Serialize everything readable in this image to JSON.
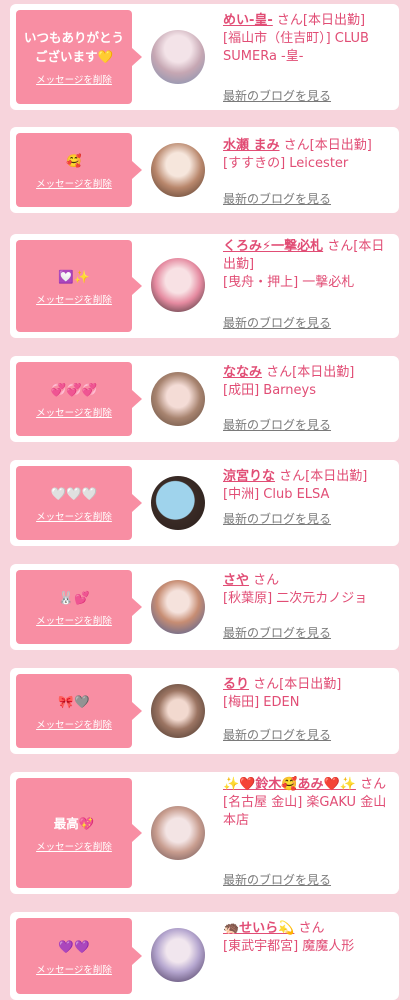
{
  "delete_label": "メッセージを削除",
  "blog_label": "最新のブログを見る",
  "cast": [
    {
      "message": "いつもありがとうございます💛",
      "name": "めい-皇-",
      "suffix": " さん[本日出勤]",
      "shop": "[福山市（住吉町）] CLUB SUMERa -皇-"
    },
    {
      "message": "🥰",
      "name": "水瀬 まみ",
      "suffix": " さん[本日出勤]",
      "shop": "[すすきの] Leicester"
    },
    {
      "message": "💟✨",
      "name": "くろみ⚡一撃必札",
      "suffix": " さん[本日出勤]",
      "shop": "[曳舟・押上] 一撃必札"
    },
    {
      "message": "💞💞💞",
      "name": "ななみ",
      "suffix": " さん[本日出勤]",
      "shop": "[成田] Barneys"
    },
    {
      "message": "🤍🤍🤍",
      "name": "涼宮りな",
      "suffix": " さん[本日出勤]",
      "shop": "[中洲] Club ELSA"
    },
    {
      "message": "🐰💕",
      "name": "さや",
      "suffix": " さん",
      "shop": "[秋葉原] 二次元カノジョ"
    },
    {
      "message": "🎀🩶",
      "name": "るり",
      "suffix": " さん[本日出勤]",
      "shop": "[梅田] EDEN"
    },
    {
      "message": "最高💖",
      "name": "✨❤️鈴木🥰あみ❤️✨",
      "suffix": " さん",
      "shop": "[名古屋 金山] 楽GAKU 金山本店"
    },
    {
      "message": "💜💜",
      "name": "🦔せいら💫",
      "suffix": " さん",
      "shop": "[東武宇都宮] 魔魔人形"
    }
  ],
  "colors": {
    "background": "#f7d4dc",
    "bubble": "#f88ea3",
    "accent": "#e14d75",
    "link_gray": "#7a7a7a"
  }
}
